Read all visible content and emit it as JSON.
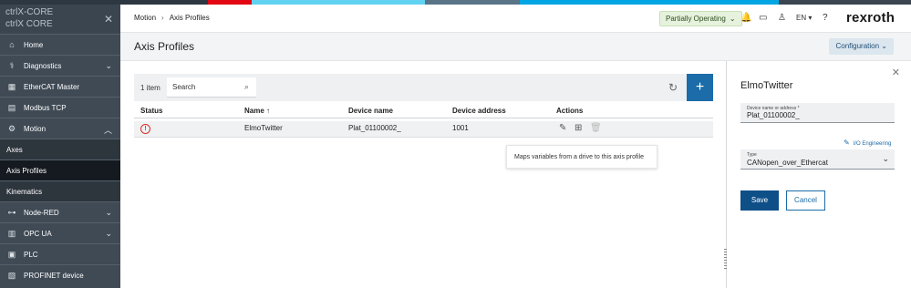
{
  "colors": {
    "band": [
      "#2d3741",
      "#2d3741",
      "#e30613",
      "#62d2f2",
      "#62d2f2",
      "#5a7487",
      "#00a6e3",
      "#00a6e3",
      "#3a4550"
    ],
    "accent": "#1b6ca8",
    "status_ok": "#e6f2dd",
    "error": "#d6322c"
  },
  "sidebar": {
    "brand_line1": "ctrlX-CORE",
    "brand_line2": "ctrlX CORE",
    "close_icon": "close-icon",
    "items": [
      {
        "label": "Home",
        "icon": "home-icon"
      },
      {
        "label": "Diagnostics",
        "icon": "diagnostics-icon",
        "expandable": true
      },
      {
        "label": "EtherCAT Master",
        "icon": "ethercat-icon"
      },
      {
        "label": "Modbus TCP",
        "icon": "modbus-icon"
      },
      {
        "label": "Motion",
        "icon": "motion-icon",
        "expanded": true
      },
      {
        "label": "Axes"
      },
      {
        "label": "Axis Profiles",
        "active": true
      },
      {
        "label": "Kinematics"
      },
      {
        "label": "Node-RED",
        "icon": "node-red-icon",
        "expandable": true
      },
      {
        "label": "OPC UA",
        "icon": "opcua-icon",
        "expandable": true
      },
      {
        "label": "PLC",
        "icon": "plc-icon"
      },
      {
        "label": "PROFINET device",
        "icon": "profinet-icon"
      }
    ]
  },
  "header": {
    "breadcrumb": [
      "Motion",
      "Axis Profiles"
    ],
    "status": "Partially Operating",
    "language": "EN",
    "logo": "rexroth"
  },
  "page": {
    "title": "Axis Profiles",
    "config_label": "Configuration"
  },
  "table": {
    "count": "1 item",
    "search_placeholder": "Search",
    "columns": [
      "Status",
      "Name",
      "Device name",
      "Device address",
      "Actions"
    ],
    "sort_indicator": "↑",
    "rows": [
      {
        "name": "ElmoTwitter",
        "device_name": "Plat_01100002_",
        "device_address": "1001",
        "status": "error"
      }
    ],
    "tooltip": "Maps variables from a drive to this axis profile"
  },
  "panel": {
    "title": "ElmoTwitter",
    "device_label": "Device name or address *",
    "device_value": "Plat_01100002_",
    "io_link": "I/O Engineering",
    "type_label": "Type",
    "type_value": "CANopen_over_Ethercat",
    "save_label": "Save",
    "cancel_label": "Cancel"
  }
}
